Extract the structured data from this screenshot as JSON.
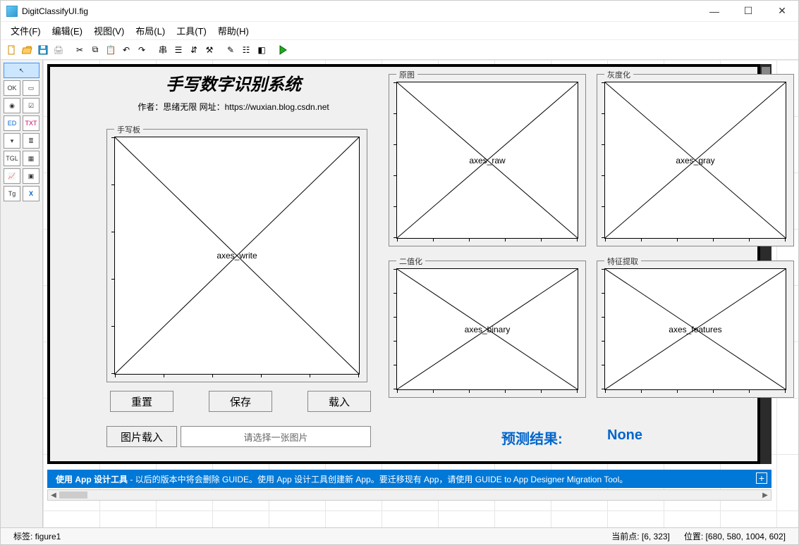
{
  "window": {
    "title": "DigitClassifyUI.fig"
  },
  "menus": {
    "file": "文件(F)",
    "edit": "编辑(E)",
    "view": "视图(V)",
    "layout": "布局(L)",
    "tools": "工具(T)",
    "help": "帮助(H)"
  },
  "header": {
    "title": "手写数字识别系统",
    "subtitle": "作者：思绪无限 网址：https://wuxian.blog.csdn.net"
  },
  "panels": {
    "write": {
      "label": "手写板",
      "axes_name": "axes_write"
    },
    "raw": {
      "label": "原图",
      "axes_name": "axes_raw"
    },
    "gray": {
      "label": "灰度化",
      "axes_name": "axes_gray"
    },
    "binary": {
      "label": "二值化",
      "axes_name": "axes_binary"
    },
    "features": {
      "label": "特征提取",
      "axes_name": "axes_features"
    }
  },
  "buttons": {
    "reset": "重置",
    "save": "保存",
    "load": "载入",
    "image_load": "图片载入"
  },
  "image_input": {
    "placeholder": "请选择一张图片"
  },
  "prediction": {
    "label": "预测结果:",
    "value": "None"
  },
  "bluebar": {
    "bold": "使用 App 设计工具",
    "rest": " - 以后的版本中将会删除 GUIDE。使用 App 设计工具创建新 App。要迁移现有 App，请使用 GUIDE to App Designer Migration Tool。"
  },
  "status": {
    "tag": "标签: figure1",
    "point": "当前点: [6, 323]",
    "position": "位置: [680, 580, 1004, 602]"
  }
}
